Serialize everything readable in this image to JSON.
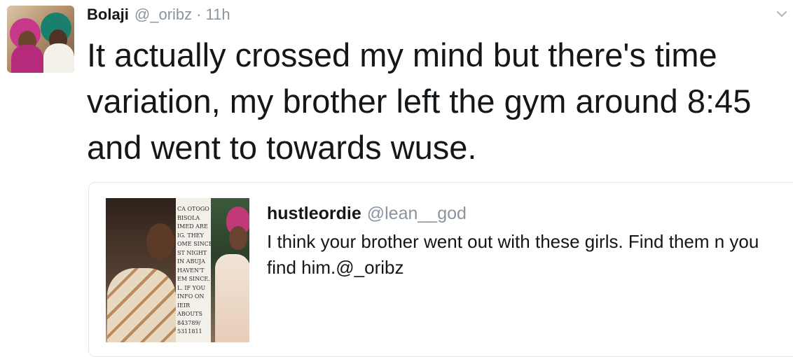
{
  "tweet": {
    "author_name": "Bolaji",
    "author_handle": "@_oribz",
    "separator": "·",
    "time": "11h",
    "text": "It actually crossed my mind but there's time variation, my brother left the gym around 8:45 and went to towards wuse.",
    "menu_icon": "chevron-down-icon"
  },
  "quoted_tweet": {
    "author_name": "hustleordie",
    "author_handle": "@lean__god",
    "text": "I think your brother went out with these girls. Find them n you find him.@_oribz",
    "image_caption": "CA OTOGO\nBISOLA\nIMED ARE\nIG. THEY\nOME SINCE\nST NIGHT\nIN ABUJA\nHAVEN'T\nEM SINCE.\nL. IF YOU\nINFO ON\nIEIR\nABOUTS\n843789/\n5311811"
  },
  "colors": {
    "text": "#14171a",
    "muted": "#8a949e",
    "border": "#e1e8ed"
  }
}
